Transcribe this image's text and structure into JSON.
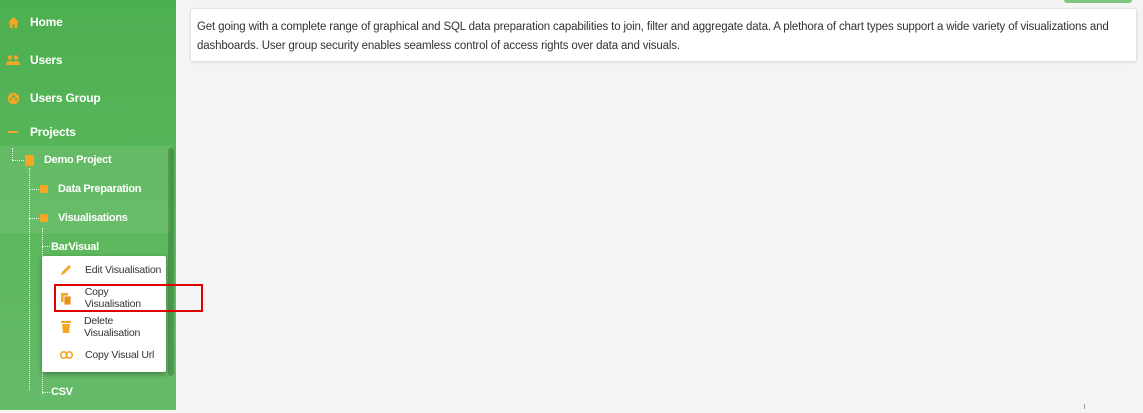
{
  "sidebar": {
    "nav": [
      {
        "label": "Home",
        "icon": "home-icon"
      },
      {
        "label": "Users",
        "icon": "users-icon"
      },
      {
        "label": "Users Group",
        "icon": "users-group-icon"
      },
      {
        "label": "Projects",
        "icon": "collapse-minus-icon"
      }
    ],
    "project": {
      "label": "Demo Project"
    },
    "folders": [
      {
        "label": "Data Preparation"
      },
      {
        "label": "Visualisations"
      }
    ],
    "leaves": [
      {
        "label": "BarVisual"
      },
      {
        "label": "CSV"
      }
    ]
  },
  "context_menu": {
    "items": [
      {
        "label": "Edit Visualisation",
        "icon": "pencil-icon"
      },
      {
        "label": "Copy Visualisation",
        "icon": "copy-icon"
      },
      {
        "label": "Delete Visualisation",
        "icon": "trash-icon"
      },
      {
        "label": "Copy Visual Url",
        "icon": "link-icon"
      }
    ]
  },
  "main": {
    "description": "Get going with a complete range of graphical and SQL data preparation capabilities to join, filter and aggregate data. A plethora of chart types support a wide variety of visualizations and dashboards. User group security enables seamless control of access rights over data and visuals."
  },
  "colors": {
    "sidebar_green": "#4caf50",
    "accent_orange": "#f5a623",
    "highlight_red": "#e00000"
  }
}
